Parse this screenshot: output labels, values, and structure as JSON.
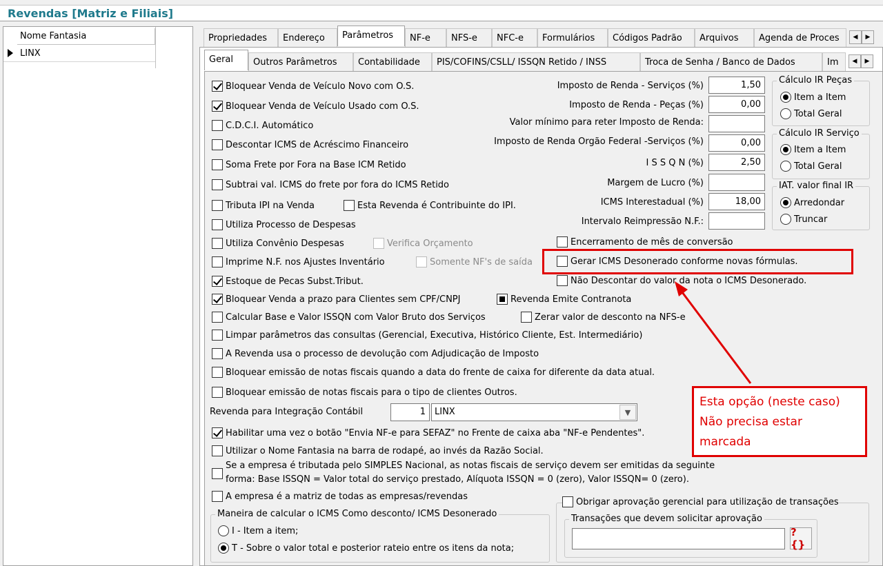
{
  "window": {
    "title": "Revendas [Matriz e Filiais]"
  },
  "grid": {
    "column_header": "Nome Fantasia",
    "rows": [
      "LINX"
    ]
  },
  "main_tabs": [
    "Propriedades",
    "Endereço",
    "Parâmetros",
    "NF-e",
    "NFS-e",
    "NFC-e",
    "Formulários",
    "Códigos Padrão",
    "Arquivos",
    "Agenda de Proces"
  ],
  "sub_tabs": [
    "Geral",
    "Outros Parâmetros",
    "Contabilidade",
    "PIS/COFINS/CSLL/ ISSQN Retido / INSS",
    "Troca de Senha / Banco de Dados",
    "Im"
  ],
  "checkboxes": {
    "c1": {
      "label": "Bloquear Venda de Veículo Novo com O.S.",
      "checked": true
    },
    "c2": {
      "label": "Bloquear Venda de Veículo Usado com O.S.",
      "checked": true
    },
    "c3": {
      "label": "C.D.C.I. Automático",
      "checked": false
    },
    "c4": {
      "label": "Descontar ICMS de Acréscimo Financeiro",
      "checked": false
    },
    "c5": {
      "label": "Soma Frete por Fora na Base ICM Retido",
      "checked": false
    },
    "c6": {
      "label": "Subtrai  val. ICMS do frete por fora do ICMS Retido",
      "checked": false
    },
    "c7": {
      "label": "Tributa IPI na Venda",
      "checked": false
    },
    "c7b": {
      "label": "Esta Revenda é Contribuinte do IPI.",
      "checked": false
    },
    "c8": {
      "label": "Utiliza Processo de Despesas",
      "checked": false
    },
    "c9": {
      "label": "Utiliza Convênio Despesas",
      "checked": false
    },
    "c9b": {
      "label": "Verifica Orçamento",
      "checked": false
    },
    "c10": {
      "label": "Imprime N.F. nos Ajustes Inventário",
      "checked": false
    },
    "c10b": {
      "label": "Somente NF's de saída",
      "checked": false
    },
    "c11": {
      "label": "Estoque de Pecas Subst.Tribut.",
      "checked": true
    },
    "c12": {
      "label": "Bloquear Venda a prazo para Clientes sem CPF/CNPJ",
      "checked": true
    },
    "c12b": {
      "label": "Revenda Emite Contranota",
      "checked": true
    },
    "c13": {
      "label": "Calcular Base e Valor ISSQN com Valor Bruto dos Serviços",
      "checked": false
    },
    "c13b": {
      "label": "Zerar valor de desconto na NFS-e",
      "checked": false
    },
    "c14": {
      "label": "Limpar parâmetros das consultas  (Gerencial, Executiva, Histórico Cliente, Est. Intermediário)",
      "checked": false
    },
    "c15": {
      "label": "A Revenda usa o processo de devolução com Adjudicação de Imposto",
      "checked": false
    },
    "c16": {
      "label": "Bloquear emissão de notas fiscais  quando a data do frente de caixa for diferente da data atual.",
      "checked": false
    },
    "c17": {
      "label": "Bloquear emissão de notas fiscais para o tipo de clientes Outros.",
      "checked": false
    },
    "c18": {
      "label": "Habilitar uma vez o botão \"Envia NF-e para SEFAZ\" no Frente de caixa aba \"NF-e Pendentes\".",
      "checked": true
    },
    "c19": {
      "label": "Utilizar o Nome Fantasia na barra de rodapé, ao invés da Razão Social.",
      "checked": false
    },
    "c20_line1": "Se a empresa é tributada pelo SIMPLES Nacional, as notas fiscais de serviço devem ser emitidas da seguinte",
    "c20_line2": "forma: Base ISSQN =  Valor total do serviço prestado, Alíquota ISSQN = 0 (zero), Valor ISSQN= 0 (zero).",
    "c21": {
      "label": "A empresa é a matriz de todas as empresas/revendas",
      "checked": false
    },
    "r1": {
      "label": "Encerramento de mês de conversão",
      "checked": false
    },
    "r2": {
      "label": "Gerar ICMS Desonerado conforme novas fórmulas.",
      "checked": false
    },
    "r3": {
      "label": "Não Descontar do valor da nota o ICMS Desonerado.",
      "checked": false
    },
    "approval": {
      "label": "Obrigar aprovação gerencial para utilização de transações",
      "checked": false
    }
  },
  "fields": [
    {
      "label": "Imposto de Renda  - Serviços (%)",
      "value": "1,50"
    },
    {
      "label": "Imposto de Renda - Peças (%)",
      "value": "0,00"
    },
    {
      "label": "Valor mínimo para reter Imposto de Renda:",
      "value": ""
    },
    {
      "label": "Imposto de Renda Orgão Federal -Serviços (%)",
      "value": "0,00"
    },
    {
      "label": "I S S Q N  (%)",
      "value": "2,50"
    },
    {
      "label": "Margem de Lucro (%)",
      "value": ""
    },
    {
      "label": "ICMS Interestadual (%)",
      "value": "18,00"
    },
    {
      "label": "Intervalo Reimpressão N.F.:",
      "value": ""
    }
  ],
  "radio_groups": {
    "ir_pecas": {
      "title": "Cálculo IR Peças",
      "options": [
        "Item a Item",
        "Total Geral"
      ],
      "selected": 0
    },
    "ir_servico": {
      "title": "Cálculo IR Serviço",
      "options": [
        "Item a Item",
        "Total Geral"
      ],
      "selected": 0
    },
    "iat": {
      "title": "IAT. valor final IR",
      "options": [
        "Arredondar",
        "Truncar"
      ],
      "selected": 0
    },
    "icms": {
      "title": "Maneira de calcular o ICMS Como desconto/ ICMS Desonerado",
      "options": [
        "I - Item a item;",
        "T - Sobre o valor total e posterior rateio entre os itens da nota;"
      ],
      "selected": 1
    }
  },
  "integracao": {
    "label": "Revenda para Integração Contábil",
    "number": "1",
    "selected": "LINX"
  },
  "approval_group": {
    "title": "Transações que devem solicitar aprovação",
    "button_label": "?{}"
  },
  "annotation": {
    "line1": "Esta opção (neste caso)",
    "line2": "Não precisa estar",
    "line3": "marcada",
    "color": "#e00000"
  }
}
